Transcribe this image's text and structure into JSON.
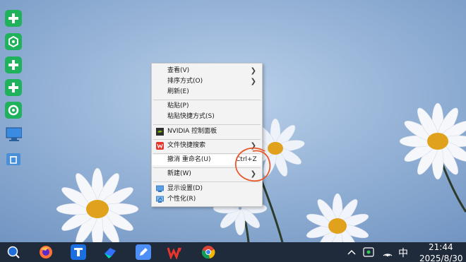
{
  "context_menu": {
    "items": [
      {
        "label": "查看(V)",
        "submenu": true
      },
      {
        "label": "排序方式(O)",
        "submenu": true
      },
      {
        "label": "刷新(E)"
      },
      {
        "label": "粘贴(P)"
      },
      {
        "label": "粘贴快捷方式(S)"
      },
      {
        "label": "NVIDIA 控制面板",
        "icon": "nvidia-icon"
      },
      {
        "label": "文件快捷搜索",
        "icon": "wps-icon",
        "submenu": true
      },
      {
        "label": "撤消 重命名(U)",
        "shortcut": "Ctrl+Z"
      },
      {
        "label": "新建(W)",
        "submenu": true
      },
      {
        "label": "显示设置(D)",
        "icon": "display-icon"
      },
      {
        "label": "个性化(R)",
        "icon": "personalize-icon"
      }
    ]
  },
  "tray": {
    "ime": "中",
    "time": "21:44",
    "date": "2025/8/30"
  },
  "colors": {
    "taskbar": "#1f2a3a",
    "annotation_circle": "#e8582a",
    "desktop_icon_green": "#20b15c"
  }
}
